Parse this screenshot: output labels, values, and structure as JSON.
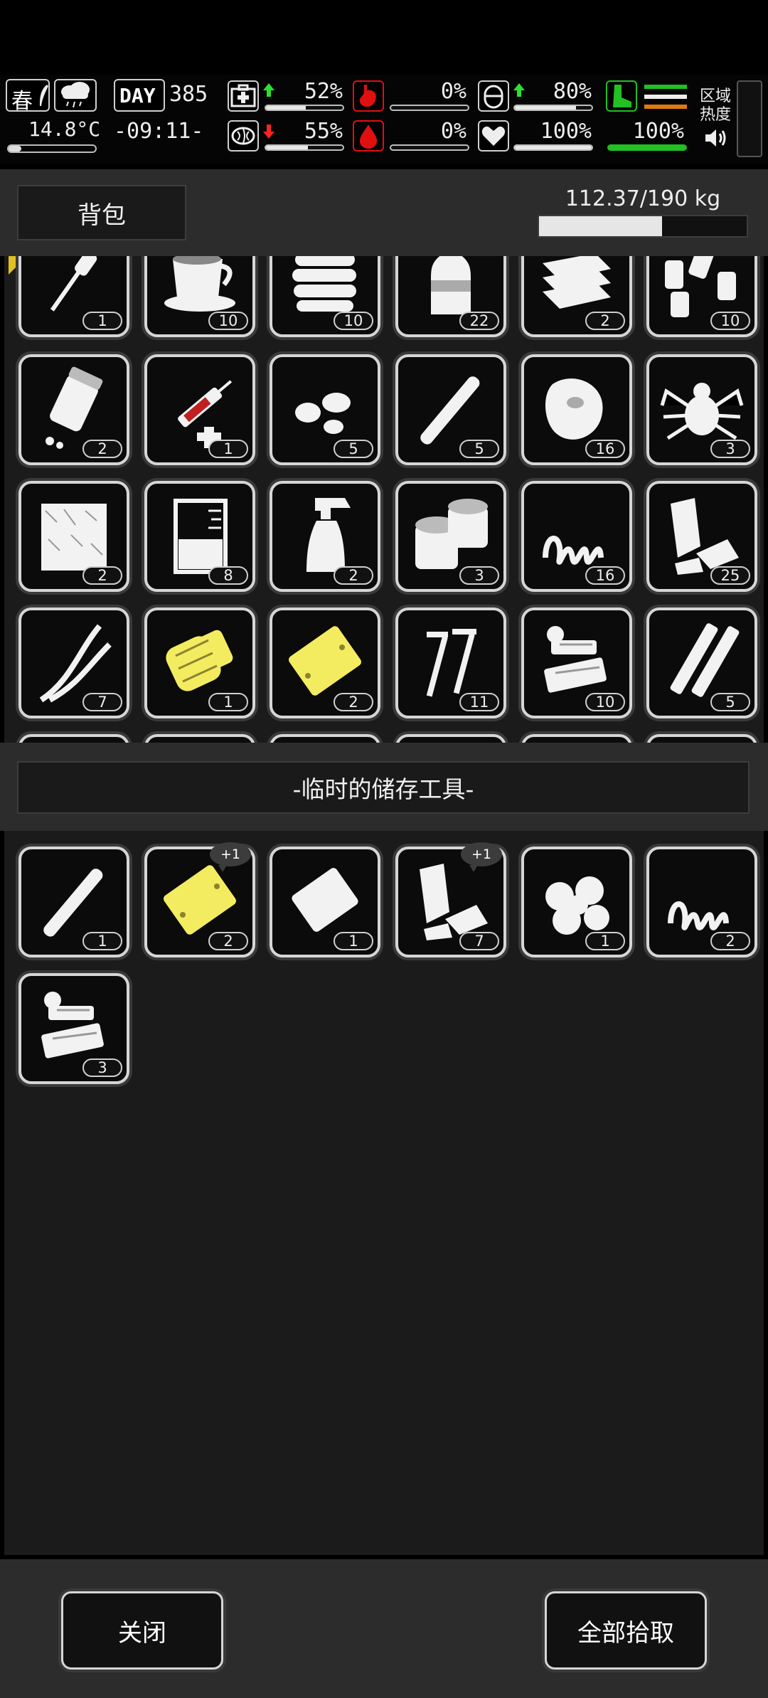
{
  "status": {
    "season": "春",
    "temperature": "14.8°C",
    "day_label": "DAY",
    "day": "385",
    "time": "-09:11-",
    "health_pct": "52%",
    "brain_pct": "55%",
    "stomach_pct": "0%",
    "blood_pct": "0%",
    "stamina_pct": "80%",
    "heart_pct": "100%",
    "legs_pct": "100%",
    "region_heat_label": "区域\n热度",
    "bars": {
      "health": 0.52,
      "brain": 0.55,
      "stomach": 0.0,
      "blood": 0.0,
      "stamina": 0.8,
      "heart": 1.0,
      "legs": 1.0
    },
    "colors": {
      "up_arrow": "#2ee02e",
      "down_arrow": "#ff2222",
      "accent_red": "#e01010",
      "accent_green": "#22c022"
    }
  },
  "backpack": {
    "title": "背包",
    "weight": "112.37/190 kg",
    "weight_fraction": 0.5914,
    "rows": [
      [
        {
          "icon": "screwdriver-icon",
          "count": "1"
        },
        {
          "icon": "coffee-cup-icon",
          "count": "10"
        },
        {
          "icon": "bread-stack-icon",
          "count": "10"
        },
        {
          "icon": "water-bottle-icon",
          "count": "22"
        },
        {
          "icon": "cloth-stack-icon",
          "count": "2"
        },
        {
          "icon": "battery-cells-icon",
          "count": "10"
        }
      ],
      [
        {
          "icon": "pill-bottle-icon",
          "count": "2"
        },
        {
          "icon": "syringe-icon",
          "count": "1"
        },
        {
          "icon": "seeds-icon",
          "count": "5"
        },
        {
          "icon": "pipe-icon",
          "count": "5"
        },
        {
          "icon": "meat-steak-icon",
          "count": "16"
        },
        {
          "icon": "spider-icon",
          "count": "3"
        }
      ],
      [
        {
          "icon": "hay-bale-icon",
          "count": "2"
        },
        {
          "icon": "beaker-icon",
          "count": "8"
        },
        {
          "icon": "spray-bottle-icon",
          "count": "2"
        },
        {
          "icon": "tape-rolls-icon",
          "count": "3"
        },
        {
          "icon": "spring-icon",
          "count": "16"
        },
        {
          "icon": "scrap-metal-icon",
          "count": "25"
        }
      ],
      [
        {
          "icon": "wires-icon",
          "count": "7"
        },
        {
          "icon": "electric-motor-icon",
          "count": "1"
        },
        {
          "icon": "metal-plate-icon",
          "count": "2"
        },
        {
          "icon": "screws-icon",
          "count": "11"
        },
        {
          "icon": "circuit-parts-icon",
          "count": "10"
        },
        {
          "icon": "metal-tubes-icon",
          "count": "5"
        }
      ]
    ]
  },
  "temp_storage": {
    "title": "-临时的储存工具-",
    "items": [
      {
        "icon": "pipe-icon",
        "count": "1",
        "badge": ""
      },
      {
        "icon": "metal-plate-icon",
        "count": "2",
        "badge": "+1"
      },
      {
        "icon": "sheet-metal-icon",
        "count": "1",
        "badge": ""
      },
      {
        "icon": "scrap-metal-icon",
        "count": "7",
        "badge": "+1"
      },
      {
        "icon": "mushrooms-icon",
        "count": "1",
        "badge": ""
      },
      {
        "icon": "spring-icon",
        "count": "2",
        "badge": ""
      },
      {
        "icon": "circuit-parts-icon",
        "count": "3",
        "badge": ""
      }
    ]
  },
  "footer": {
    "close_label": "关闭",
    "pickup_all_label": "全部拾取"
  }
}
